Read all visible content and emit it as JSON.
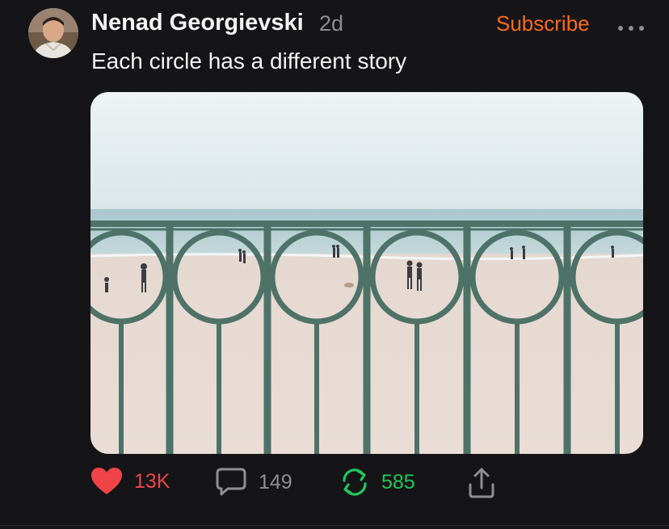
{
  "post": {
    "author": "Nenad Georgievski",
    "age": "2d",
    "subscribe_label": "Subscribe",
    "text": "Each circle has a different story",
    "avatar_icon": "avatar-photo",
    "image_icon": "beach-railing-photo"
  },
  "actions": {
    "likes": "13K",
    "comments": "149",
    "reposts": "585",
    "like_icon": "heart-icon",
    "comment_icon": "comment-icon",
    "repost_icon": "repost-icon",
    "share_icon": "share-icon"
  },
  "colors": {
    "background": "#151517",
    "accent": "#ff6a1a",
    "like": "#f04448",
    "repost": "#22c55e",
    "muted": "#8e8e93"
  }
}
